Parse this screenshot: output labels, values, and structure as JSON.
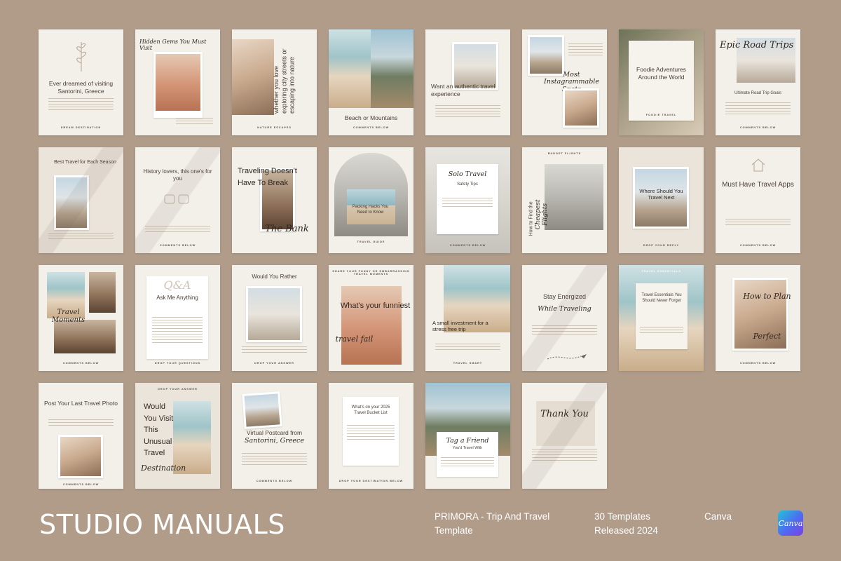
{
  "brand": "STUDIO MANUALS",
  "product": {
    "line1": "PRIMORA - Trip And Travel",
    "line2": "Template"
  },
  "stats": {
    "line1": "30 Templates",
    "line2": "Released 2024"
  },
  "platform": "Canva",
  "canva_logo_text": "Canva",
  "colors": {
    "background": "#b09c89",
    "card": "#f3efe9",
    "text": "#ffffff"
  },
  "cards": [
    {
      "headline": "Ever dreamed of visiting Santorini, Greece",
      "footer": "DREAM DESTINATION"
    },
    {
      "script": "Hidden Gems You Must Visit"
    },
    {
      "headline": "whether you love exploring city streets or escaping into nature",
      "footer": "NATURE ESCAPES"
    },
    {
      "headline": "Beach or Mountains",
      "footer": "COMMENTS BELOW"
    },
    {
      "headline": "Want an authentic travel experience"
    },
    {
      "script": "Most Instagrammable Spots"
    },
    {
      "headline": "Foodie Adventures Around the World",
      "footer": "FOODIE TRAVEL"
    },
    {
      "script": "Epic Road Trips",
      "headline": "Ultimate Road Trip Goals",
      "footer": "COMMENTS BELOW"
    },
    {
      "headline": "Best Travel for Each Season"
    },
    {
      "headline": "History lovers, this one's for you",
      "footer": "COMMENTS BELOW"
    },
    {
      "headline": "Traveling Doesn't Have To Break",
      "script": "The Bank"
    },
    {
      "headline": "Packing Hacks You Need to Know",
      "footer": "TRAVEL GUIDE"
    },
    {
      "script": "Solo Travel",
      "headline": "Safety Tips",
      "footer": "COMMENTS BELOW"
    },
    {
      "headline": "How to Find the",
      "script": "Cheapest Flights",
      "footer": "BUDGET FLIGHTS"
    },
    {
      "headline": "Where Should You Travel Next",
      "footer": "DROP YOUR REPLY"
    },
    {
      "headline": "Must Have Travel Apps",
      "footer": "COMMENTS BELOW"
    },
    {
      "script": "Travel Moments"
    },
    {
      "script": "Q&A",
      "headline": "Ask Me Anything",
      "footer": "DROP YOUR QUESTIONS"
    },
    {
      "headline": "Would You Rather",
      "footer": "DROP YOUR ANSWER"
    },
    {
      "headline": "What's your funniest",
      "script": "travel fail"
    },
    {
      "headline": "A small investment for a stress free trip",
      "footer": "TRAVEL SMART"
    },
    {
      "headline": "Stay Energized",
      "script": "While Traveling"
    },
    {
      "headline": "Travel Essentials You Should Never Forget",
      "footer": "TRAVEL ESSENTIALS"
    },
    {
      "script": "How to Plan Perfect Itinerary",
      "footer": "COMMENTS BELOW"
    },
    {
      "headline": "Post Your Last Travel Photo",
      "footer": "COMMENTS BELOW"
    },
    {
      "headline": "Would You Visit This Unusual Travel",
      "script": "Destination",
      "footer": "DROP YOUR ANSWER"
    },
    {
      "headline": "Virtual Postcard from",
      "script": "Santorini, Greece",
      "footer": "COMMENTS BELOW"
    },
    {
      "headline": "What's on your 2025 Travel Bucket List",
      "footer": "DROP YOUR DESTINATION BELOW"
    },
    {
      "script": "Tag a Friend",
      "headline": "You'd Travel With"
    },
    {
      "script": "Thank You"
    }
  ]
}
